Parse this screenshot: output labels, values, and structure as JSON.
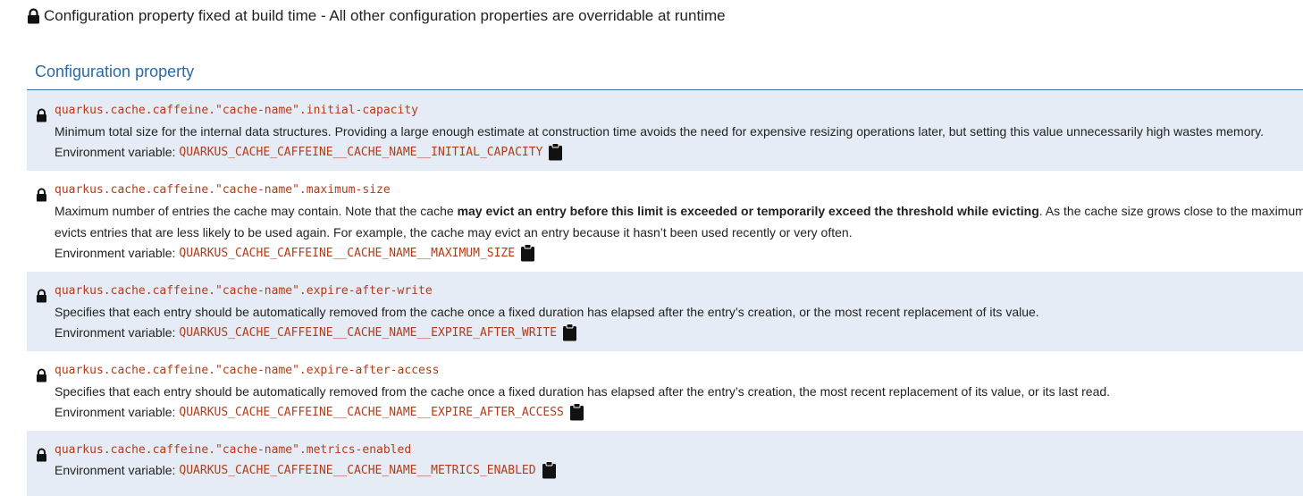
{
  "legend": {
    "icon": "lock-icon",
    "text": "Configuration property fixed at build time - All other configuration properties are overridable at runtime"
  },
  "table": {
    "header": "Configuration property",
    "env_label": "Environment variable:",
    "rows": [
      {
        "name": "quarkus.cache.caffeine.\"cache-name\".initial-capacity",
        "description": "Minimum total size for the internal data structures. Providing a large enough estimate at construction time avoids the need for expensive resizing operations later, but setting this value unnecessarily high wastes memory.",
        "env": "QUARKUS_CACHE_CAFFEINE__CACHE_NAME__INITIAL_CAPACITY"
      },
      {
        "name": "quarkus.cache.caffeine.\"cache-name\".maximum-size",
        "description_part1": "Maximum number of entries the cache may contain. Note that the cache ",
        "description_bold": "may evict an entry before this limit is exceeded or temporarily exceed the threshold while evicting",
        "description_part2": ". As the cache size grows close to the maximum, the cac",
        "description_line2": "evicts entries that are less likely to be used again. For example, the cache may evict an entry because it hasn’t been used recently or very often.",
        "env": "QUARKUS_CACHE_CAFFEINE__CACHE_NAME__MAXIMUM_SIZE"
      },
      {
        "name": "quarkus.cache.caffeine.\"cache-name\".expire-after-write",
        "description": "Specifies that each entry should be automatically removed from the cache once a fixed duration has elapsed after the entry’s creation, or the most recent replacement of its value.",
        "env": "QUARKUS_CACHE_CAFFEINE__CACHE_NAME__EXPIRE_AFTER_WRITE"
      },
      {
        "name": "quarkus.cache.caffeine.\"cache-name\".expire-after-access",
        "description": "Specifies that each entry should be automatically removed from the cache once a fixed duration has elapsed after the entry’s creation, the most recent replacement of its value, or its last read.",
        "env": "QUARKUS_CACHE_CAFFEINE__CACHE_NAME__EXPIRE_AFTER_ACCESS"
      },
      {
        "name": "quarkus.cache.caffeine.\"cache-name\".metrics-enabled",
        "env": "QUARKUS_CACHE_CAFFEINE__CACHE_NAME__METRICS_ENABLED"
      }
    ]
  },
  "colors": {
    "accent": "#2a6aa8",
    "code": "#b53b17",
    "row_shade": "#e6ecf5"
  }
}
